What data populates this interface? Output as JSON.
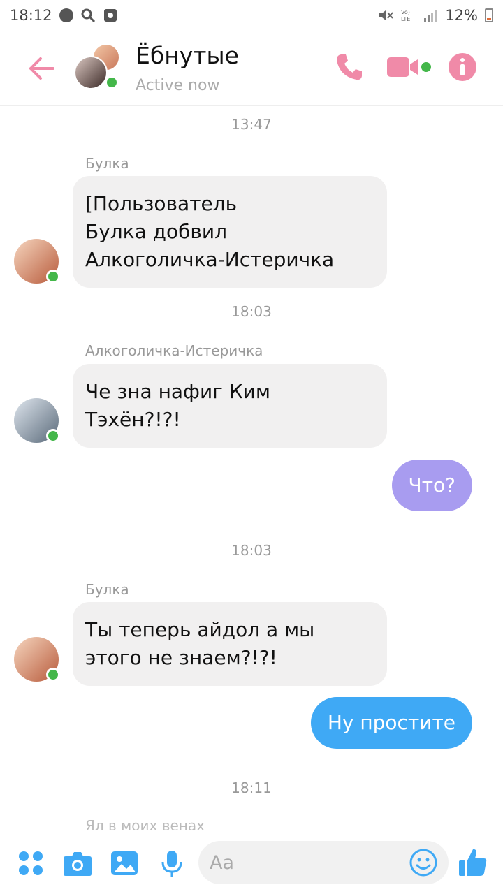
{
  "status_bar": {
    "time": "18:12",
    "battery": "12%"
  },
  "header": {
    "title": "Ёбнутые",
    "status": "Active now"
  },
  "messages": [
    {
      "type": "timestamp",
      "text": "13:47"
    },
    {
      "type": "incoming",
      "sender": "Булка",
      "text": "[Пользователь\nБулка добвил\nАлкоголичка-Истеричка"
    },
    {
      "type": "timestamp",
      "text": "18:03"
    },
    {
      "type": "incoming",
      "sender": "Алкоголичка-Истеричка",
      "text": "Че зна нафиг Ким\nТэхён?!?!"
    },
    {
      "type": "outgoing",
      "text": "Что?"
    },
    {
      "type": "timestamp",
      "text": "18:03"
    },
    {
      "type": "incoming",
      "sender": "Булка",
      "text": "Ты теперь айдол а мы\nэтого не знаем?!?!"
    },
    {
      "type": "outgoing",
      "text": "Ну простите"
    },
    {
      "type": "timestamp",
      "text": "18:11"
    }
  ],
  "partial_sender": "Ял в моих венах",
  "composer": {
    "placeholder": "Aa"
  },
  "colors": {
    "accent": "#f08aa8",
    "bubble_out_purple": "#a89cf0",
    "bubble_out_blue": "#3fa9f5",
    "online": "#44b74a"
  }
}
